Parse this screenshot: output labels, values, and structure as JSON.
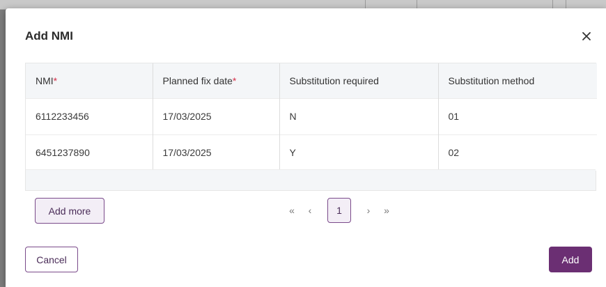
{
  "dialog": {
    "title": "Add NMI",
    "close_icon": "close-icon"
  },
  "table": {
    "columns": [
      {
        "label": "NMI",
        "required": true
      },
      {
        "label": "Planned fix date",
        "required": true
      },
      {
        "label": "Substitution required",
        "required": false
      },
      {
        "label": "Substitution method",
        "required": false
      }
    ],
    "required_marker": "*",
    "rows": [
      [
        "6112233456",
        "17/03/2025",
        "N",
        "01"
      ],
      [
        "6451237890",
        "17/03/2025",
        "Y",
        "02"
      ]
    ]
  },
  "pagination": {
    "first": "«",
    "prev": "‹",
    "current_page": "1",
    "next": "›",
    "last": "»"
  },
  "actions": {
    "add_more_label": "Add more",
    "cancel_label": "Cancel",
    "add_label": "Add"
  },
  "colors": {
    "primary": "#6b2f73",
    "required": "#d6314b",
    "header_bg": "#f4f6f8"
  }
}
